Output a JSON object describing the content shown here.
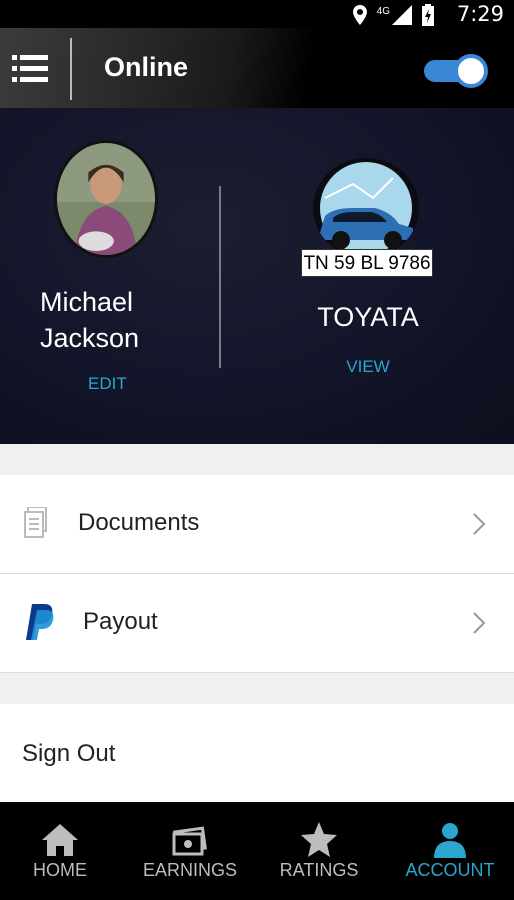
{
  "status_bar": {
    "time": "7:29",
    "network": "4G",
    "icons": [
      "location-icon",
      "signal-icon",
      "battery-charging-icon"
    ]
  },
  "app_bar": {
    "title": "Online",
    "online_toggle": true,
    "accent_color": "#3a87d6"
  },
  "profile": {
    "name_line1": "Michael",
    "name_line2": "Jackson",
    "edit_label": "EDIT"
  },
  "vehicle": {
    "plate": "TN 59 BL 9786",
    "name": "TOYATA",
    "view_label": "VIEW"
  },
  "menu": [
    {
      "label": "Documents",
      "icon": "documents-icon"
    },
    {
      "label": "Payout",
      "icon": "paypal-icon"
    }
  ],
  "sign_out_label": "Sign Out",
  "bottom_nav": [
    {
      "label": "HOME",
      "icon": "home-icon",
      "active": false
    },
    {
      "label": "EARNINGS",
      "icon": "earnings-icon",
      "active": false
    },
    {
      "label": "RATINGS",
      "icon": "star-icon",
      "active": false
    },
    {
      "label": "ACCOUNT",
      "icon": "person-icon",
      "active": true
    }
  ],
  "colors": {
    "link": "#2aa6cf",
    "nav_active": "#2aa6cf"
  }
}
